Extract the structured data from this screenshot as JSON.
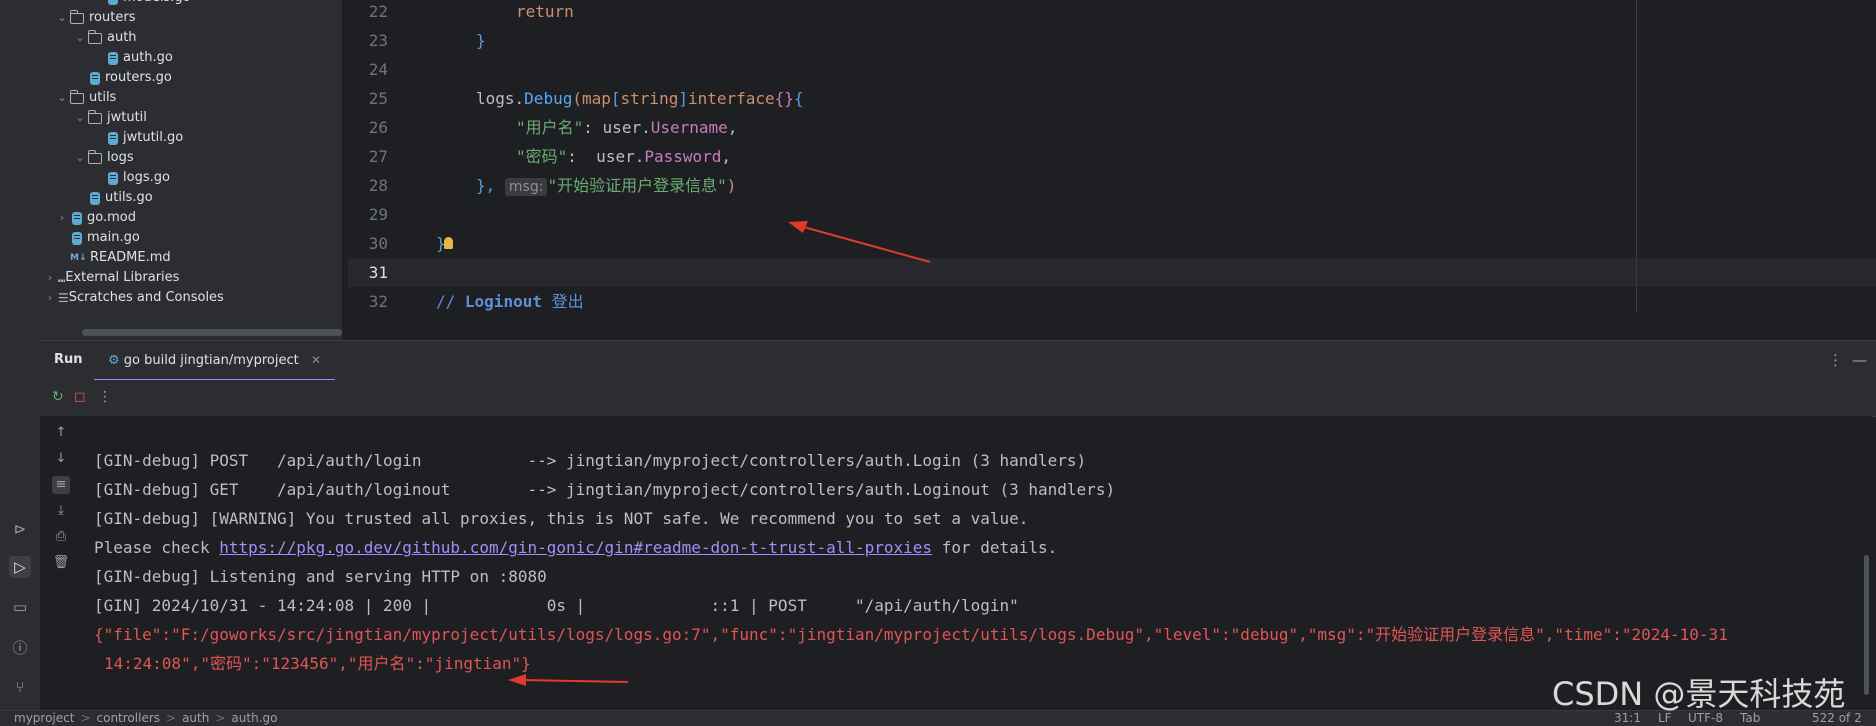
{
  "project_tree": {
    "items": [
      {
        "label": "models.go",
        "type": "go-file",
        "depth": 4
      },
      {
        "label": "routers",
        "type": "folder",
        "depth": 2,
        "expanded": true
      },
      {
        "label": "auth",
        "type": "folder",
        "depth": 3,
        "expanded": true
      },
      {
        "label": "auth.go",
        "type": "go-file",
        "depth": 4
      },
      {
        "label": "routers.go",
        "type": "go-file",
        "depth": 3
      },
      {
        "label": "utils",
        "type": "folder",
        "depth": 2,
        "expanded": true
      },
      {
        "label": "jwtutil",
        "type": "folder",
        "depth": 3,
        "expanded": true
      },
      {
        "label": "jwtutil.go",
        "type": "go-file",
        "depth": 4
      },
      {
        "label": "logs",
        "type": "folder",
        "depth": 3,
        "expanded": true
      },
      {
        "label": "logs.go",
        "type": "go-file",
        "depth": 4
      },
      {
        "label": "utils.go",
        "type": "go-file",
        "depth": 3
      },
      {
        "label": "go.mod",
        "type": "gomod-file",
        "depth": 2,
        "expanded": false
      },
      {
        "label": "main.go",
        "type": "go-file",
        "depth": 2
      },
      {
        "label": "README.md",
        "type": "md-file",
        "depth": 2
      },
      {
        "label": "External Libraries",
        "type": "library",
        "depth": 1,
        "expanded": false
      },
      {
        "label": "Scratches and Consoles",
        "type": "scratch",
        "depth": 1,
        "expanded": false
      }
    ]
  },
  "editor": {
    "line_numbers": [
      "22",
      "23",
      "24",
      "25",
      "26",
      "27",
      "28",
      "29",
      "30",
      "31",
      "32"
    ],
    "current_line": "31",
    "code": {
      "l22_return": "return",
      "l23_brace": "}",
      "l25_logs": "logs",
      "l25_dot": ".",
      "l25_debug": "Debug",
      "l25_paren": "(",
      "l25_map": "map",
      "l25_lb": "[",
      "l25_string": "string",
      "l25_rb": "]",
      "l25_interface": "interface",
      "l25_braces": "{}",
      "l25_open": "{",
      "l26_key": "\"用户名\"",
      "l26_colon": ": user.",
      "l26_field": "Username",
      "l26_comma": ",",
      "l27_key": "\"密码\"",
      "l27_colon": ":  user.",
      "l27_field": "Password",
      "l27_comma": ",",
      "l28_close": "},",
      "l28_hint": "msg:",
      "l28_msg": "\"开始验证用户登录信息\"",
      "l28_paren": ")",
      "l30_brace": "}",
      "l32_comment_prefix": "// ",
      "l32_comment_name": "Loginout",
      "l32_comment_text": " 登出"
    }
  },
  "run_window": {
    "title": "Run",
    "tab_label": "go build jingtian/myproject",
    "console_lines": [
      "[GIN-debug] POST   /api/auth/login           --> jingtian/myproject/controllers/auth.Login (3 handlers)",
      "[GIN-debug] GET    /api/auth/loginout        --> jingtian/myproject/controllers/auth.Loginout (3 handlers)",
      "[GIN-debug] [WARNING] You trusted all proxies, this is NOT safe. We recommend you to set a value."
    ],
    "check_prefix": "Please check ",
    "check_link": "https://pkg.go.dev/github.com/gin-gonic/gin#readme-don-t-trust-all-proxies",
    "check_suffix": " for details.",
    "listening_line": "[GIN-debug] Listening and serving HTTP on :8080",
    "gin_line": "[GIN] 2024/10/31 - 14:24:08 | 200 |            0s |             ::1 | POST     \"/api/auth/login\"",
    "json_line_1": "{\"file\":\"F:/goworks/src/jingtian/myproject/utils/logs/logs.go:7\",\"func\":\"jingtian/myproject/utils/logs.Debug\",\"level\":\"debug\",\"msg\":\"开始验证用户登录信息\",\"time\":\"2024-10-31",
    "json_line_2": "14:24:08\",\"密码\":\"123456\",\"用户名\":\"jingtian\"}"
  },
  "status_bar": {
    "breadcrumb": [
      "myproject",
      "controllers",
      "auth",
      "auth.go"
    ],
    "position": "31:1",
    "line_ending": "LF",
    "encoding": "UTF-8",
    "indent": "Tab",
    "memory": "522 of 2"
  },
  "watermark": "CSDN @景天科技苑",
  "colors": {
    "background": "#1e1f22",
    "panel": "#2b2d30",
    "keyword": "#cf8e6d",
    "string": "#6aab73",
    "error_text": "#e05555",
    "link": "#a78bfa",
    "annotation_arrow": "#e03a2f"
  }
}
